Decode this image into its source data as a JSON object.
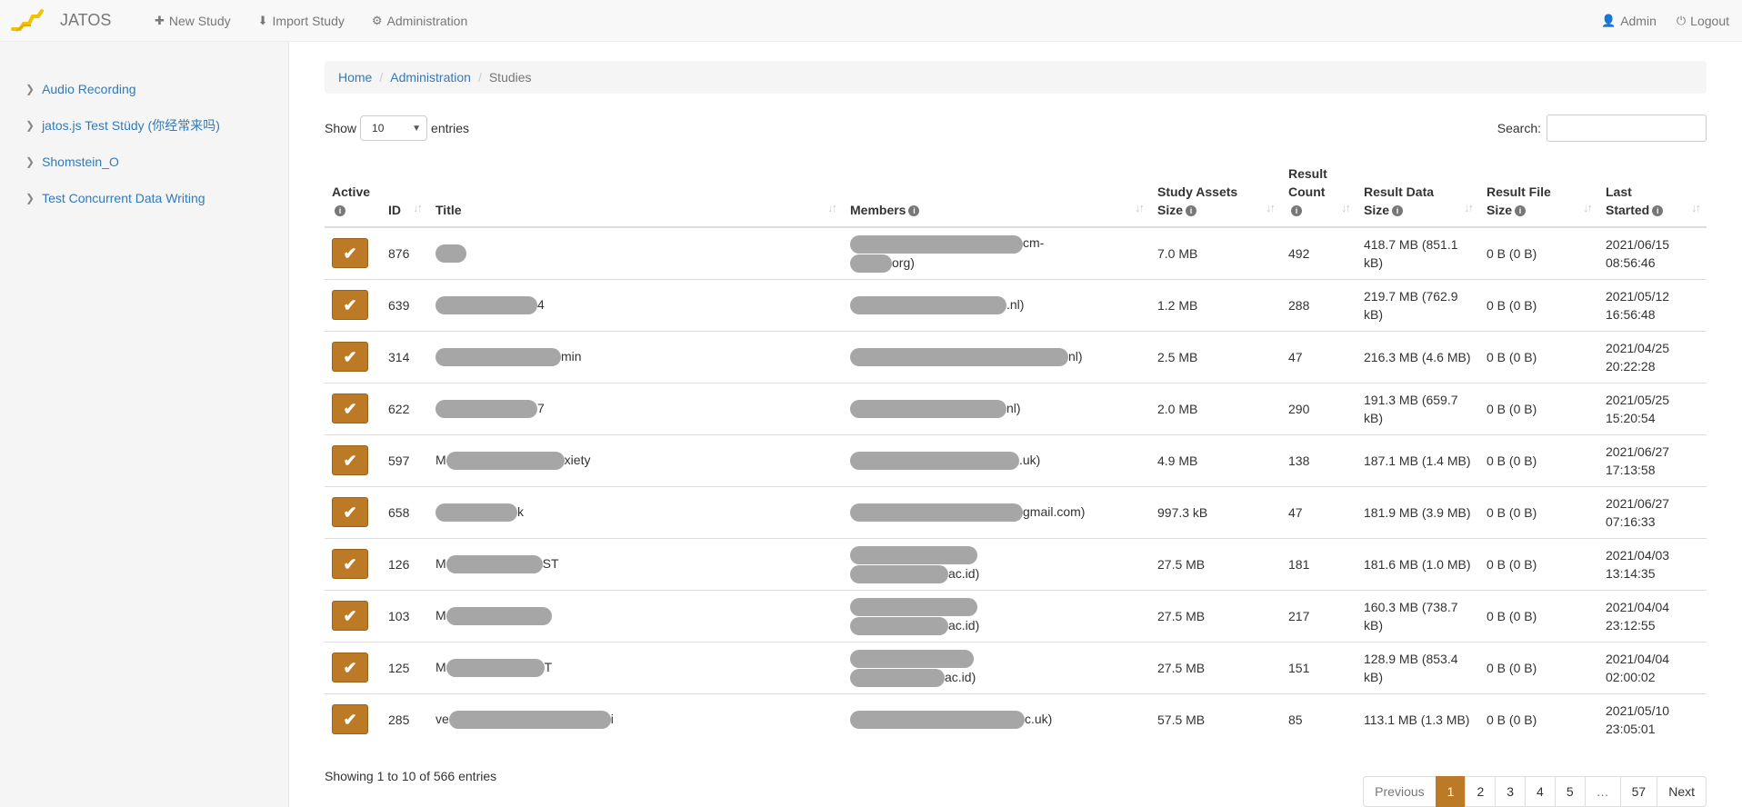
{
  "navbar": {
    "brand": "JATOS",
    "new_study": "New Study",
    "import_study": "Import Study",
    "administration": "Administration",
    "user": "Admin",
    "logout": "Logout"
  },
  "sidebar": {
    "items": [
      {
        "label": "Audio Recording"
      },
      {
        "label": "jatos.js Test Stüdy (你经常来吗)"
      },
      {
        "label": "Shomstein_O"
      },
      {
        "label": "Test Concurrent Data Writing"
      }
    ]
  },
  "breadcrumb": {
    "home": "Home",
    "administration": "Administration",
    "current": "Studies"
  },
  "controls": {
    "show": "Show",
    "entries_value": "10",
    "entries": "entries",
    "search_label": "Search:"
  },
  "table": {
    "headers": {
      "active": "Active",
      "id": "ID",
      "title": "Title",
      "members": "Members",
      "assets_1": "Study Assets",
      "assets_2": "Size",
      "count_1": "Result",
      "count_2": "Count",
      "data_1": "Result Data",
      "data_2": "Size",
      "file_1": "Result File",
      "file_2": "Size",
      "last_1": "Last",
      "last_2": "Started"
    },
    "rows": [
      {
        "id": "876",
        "title_pre": "",
        "title_post": "",
        "members_l1": "cm-",
        "members_l2": "org)",
        "assets": "7.0 MB",
        "count": "492",
        "data_l1": "418.7 MB (851.1",
        "data_l2": "kB)",
        "file": "0 B (0 B)",
        "date": "2021/06/15",
        "time": "08:56:46"
      },
      {
        "id": "639",
        "title_pre": "",
        "title_post": "4",
        "members_l1": ".nl)",
        "members_l2": "",
        "assets": "1.2 MB",
        "count": "288",
        "data_l1": "219.7 MB (762.9",
        "data_l2": "kB)",
        "file": "0 B (0 B)",
        "date": "2021/05/12",
        "time": "16:56:48"
      },
      {
        "id": "314",
        "title_pre": "",
        "title_post": "min",
        "members_l1": "nl)",
        "members_l2": "",
        "assets": "2.5 MB",
        "count": "47",
        "data_l1": "216.3 MB (4.6 MB)",
        "data_l2": "",
        "file": "0 B (0 B)",
        "date": "2021/04/25",
        "time": "20:22:28"
      },
      {
        "id": "622",
        "title_pre": "",
        "title_post": "7",
        "members_l1": "nl)",
        "members_l2": "",
        "assets": "2.0 MB",
        "count": "290",
        "data_l1": "191.3 MB (659.7",
        "data_l2": "kB)",
        "file": "0 B (0 B)",
        "date": "2021/05/25",
        "time": "15:20:54"
      },
      {
        "id": "597",
        "title_pre": "M",
        "title_post": "xiety",
        "members_l1": ".uk)",
        "members_l2": "",
        "assets": "4.9 MB",
        "count": "138",
        "data_l1": "187.1 MB (1.4 MB)",
        "data_l2": "",
        "file": "0 B (0 B)",
        "date": "2021/06/27",
        "time": "17:13:58"
      },
      {
        "id": "658",
        "title_pre": "",
        "title_post": "k",
        "members_l1": "gmail.com)",
        "members_l2": "",
        "assets": "997.3 kB",
        "count": "47",
        "data_l1": "181.9 MB (3.9 MB)",
        "data_l2": "",
        "file": "0 B (0 B)",
        "date": "2021/06/27",
        "time": "07:16:33"
      },
      {
        "id": "126",
        "title_pre": "M",
        "title_post": "ST",
        "members_l1": "",
        "members_l2": "ac.id)",
        "assets": "27.5 MB",
        "count": "181",
        "data_l1": "181.6 MB (1.0 MB)",
        "data_l2": "",
        "file": "0 B (0 B)",
        "date": "2021/04/03",
        "time": "13:14:35"
      },
      {
        "id": "103",
        "title_pre": "M",
        "title_post": "",
        "members_l1": "",
        "members_l2": "ac.id)",
        "assets": "27.5 MB",
        "count": "217",
        "data_l1": "160.3 MB (738.7",
        "data_l2": "kB)",
        "file": "0 B (0 B)",
        "date": "2021/04/04",
        "time": "23:12:55"
      },
      {
        "id": "125",
        "title_pre": "M",
        "title_post": "T",
        "members_l1": "",
        "members_l2": "ac.id)",
        "assets": "27.5 MB",
        "count": "151",
        "data_l1": "128.9 MB (853.4",
        "data_l2": "kB)",
        "file": "0 B (0 B)",
        "date": "2021/04/04",
        "time": "02:00:02"
      },
      {
        "id": "285",
        "title_pre": "ve",
        "title_post": "i",
        "members_l1": "c.uk)",
        "members_l2": "",
        "assets": "57.5 MB",
        "count": "85",
        "data_l1": "113.1 MB (1.3 MB)",
        "data_l2": "",
        "file": "0 B (0 B)",
        "date": "2021/05/10",
        "time": "23:05:01"
      }
    ]
  },
  "footer": {
    "info": "Showing 1 to 10 of 566 entries",
    "pagination": {
      "previous": "Previous",
      "pages": [
        "1",
        "2",
        "3",
        "4",
        "5",
        "…",
        "57"
      ],
      "next": "Next"
    }
  },
  "colors": {
    "accent": "#bc7a27",
    "link": "#337ab7",
    "redaction": "#a6a6a6"
  }
}
